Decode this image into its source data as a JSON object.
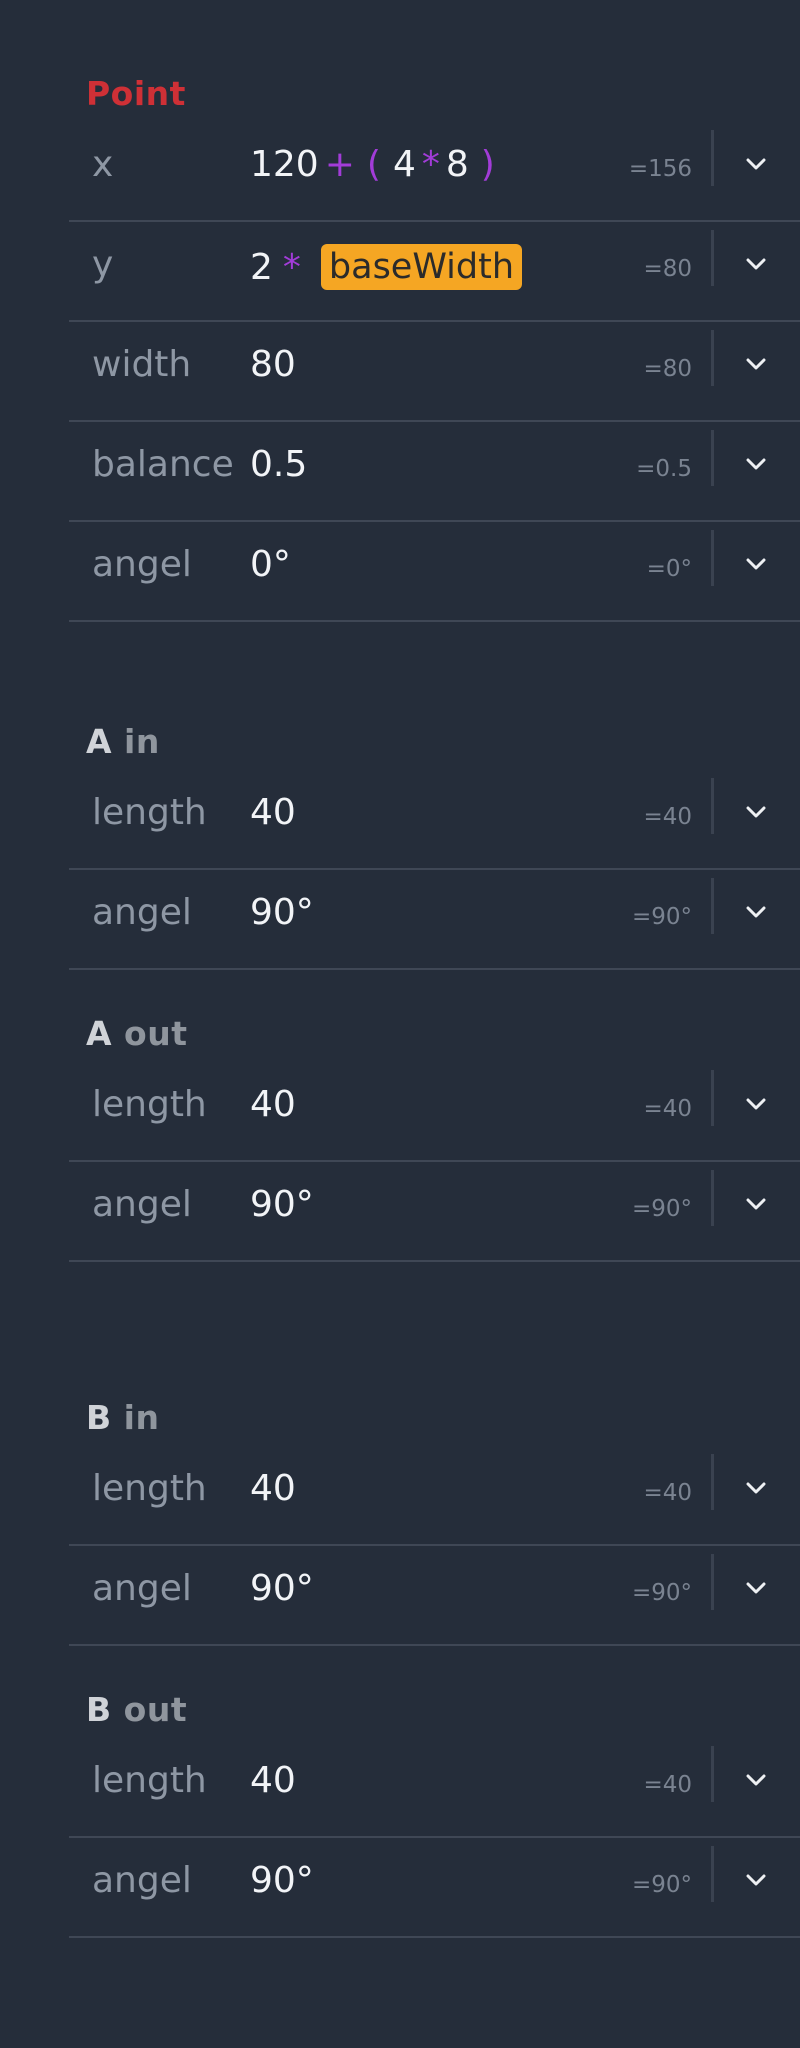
{
  "sections": {
    "point": {
      "title": "Point",
      "rows": {
        "x": {
          "label": "x",
          "t0": "120",
          "t1": "+",
          "t2": "(",
          "t3": "4",
          "t4": "*",
          "t5": "8",
          "t6": ")",
          "result": "=156"
        },
        "y": {
          "label": "y",
          "t0": "2",
          "t1": "*",
          "var": "baseWidth",
          "result": "=80"
        },
        "width": {
          "label": "width",
          "value": "80",
          "result": "=80"
        },
        "balance": {
          "label": "balance",
          "value": "0.5",
          "result": "=0.5"
        },
        "angel": {
          "label": "angel",
          "value": "0°",
          "result": "=0°"
        }
      }
    },
    "a_in": {
      "title_main": "A",
      "title_sub": "in",
      "length": {
        "label": "length",
        "value": "40",
        "result": "=40"
      },
      "angel": {
        "label": "angel",
        "value": "90°",
        "result": "=90°"
      }
    },
    "a_out": {
      "title_main": "A",
      "title_sub": "out",
      "length": {
        "label": "length",
        "value": "40",
        "result": "=40"
      },
      "angel": {
        "label": "angel",
        "value": "90°",
        "result": "=90°"
      }
    },
    "b_in": {
      "title_main": "B",
      "title_sub": "in",
      "length": {
        "label": "length",
        "value": "40",
        "result": "=40"
      },
      "angel": {
        "label": "angel",
        "value": "90°",
        "result": "=90°"
      }
    },
    "b_out": {
      "title_main": "B",
      "title_sub": "out",
      "length": {
        "label": "length",
        "value": "40",
        "result": "=40"
      },
      "angel": {
        "label": "angel",
        "value": "90°",
        "result": "=90°"
      }
    }
  },
  "colors": {
    "background": "#252d3a",
    "point_title": "#cf3036",
    "operator": "#a23cd8",
    "variable_chip": "#f5a623"
  },
  "icons": {
    "expand": "chevron-down-icon"
  }
}
